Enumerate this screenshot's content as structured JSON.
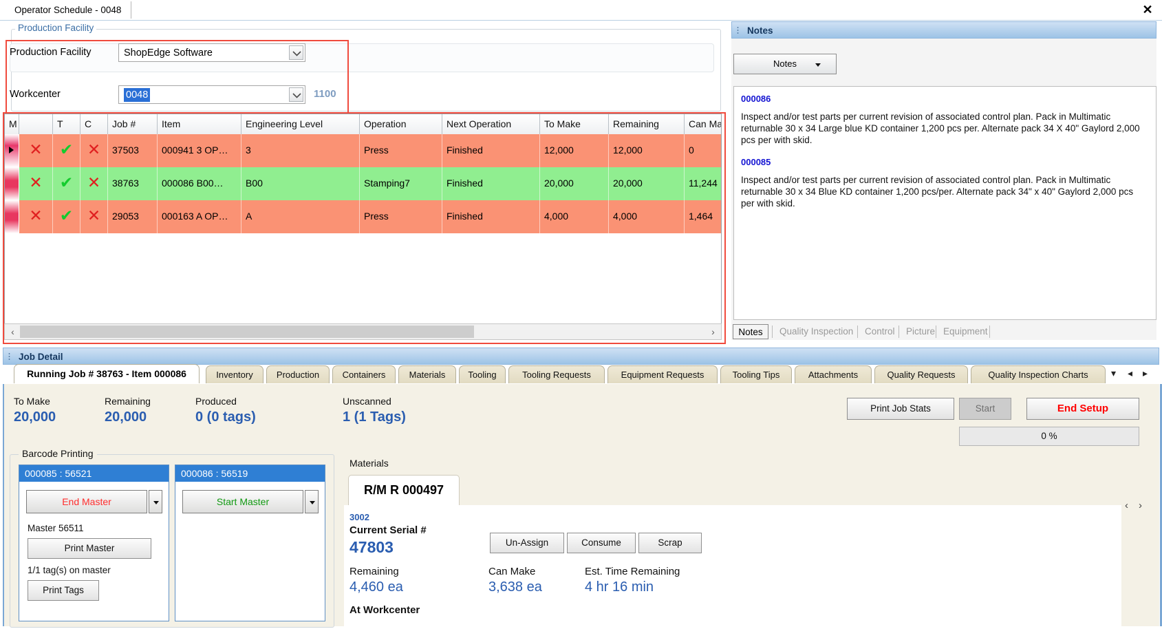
{
  "window": {
    "tab_title": "Operator Schedule - 0048",
    "close_icon": "close-icon"
  },
  "production_facility": {
    "legend": "Production Facility",
    "facility_label": "Production Facility",
    "facility_value": "ShopEdge Software",
    "workcenter_label": "Workcenter",
    "workcenter_value": "0048",
    "workcenter_code": "1100",
    "highlight_color": "#f04a3d"
  },
  "grid": {
    "columns": [
      "M",
      "",
      "T",
      "C",
      "Job #",
      "Item",
      "Engineering Level",
      "Operation",
      "Next Operation",
      "To Make",
      "Remaining",
      "Can Ma"
    ],
    "rows": [
      {
        "current": true,
        "m": "✕",
        "t": "✔",
        "c": "✕",
        "job": "37503",
        "item": "000941  3  OP…",
        "eng_level": "3",
        "operation": "Press",
        "next_operation": "Finished",
        "to_make": "12,000",
        "remaining": "12,000",
        "can_make": "0",
        "color": "#fa9274"
      },
      {
        "current": false,
        "m": "✕",
        "t": "✔",
        "c": "✕",
        "job": "38763",
        "item": "000086  B00…",
        "eng_level": "B00",
        "operation": "Stamping7",
        "next_operation": "Finished",
        "to_make": "20,000",
        "remaining": "20,000",
        "can_make": "11,244",
        "color": "#90ee90"
      },
      {
        "current": false,
        "m": "✕",
        "t": "✔",
        "c": "✕",
        "job": "29053",
        "item": "000163  A  OP…",
        "eng_level": "A",
        "operation": "Press",
        "next_operation": "Finished",
        "to_make": "4,000",
        "remaining": "4,000",
        "can_make": "1,464",
        "color": "#fa9274"
      }
    ],
    "scroll_left_icon": "chevron-left-icon",
    "scroll_right_icon": "chevron-right-icon"
  },
  "notes": {
    "panel_title": "Notes",
    "dropdown_label": "Notes",
    "entries": [
      {
        "id": "000086",
        "text": "Inspect and/or test parts per current revision of associated control plan. Pack in Multimatic returnable 30 x 34 Large blue KD container 1,200 pcs per. Alternate pack 34 X 40\" Gaylord 2,000 pcs per with skid."
      },
      {
        "id": "000085",
        "text": "Inspect and/or test parts per current revision of associated control plan. Pack in Multimatic returnable 30 x 34 Blue KD container 1,200 pcs/per. Alternate pack 34\" x 40\" Gaylord 2,000 pcs per with skid."
      }
    ],
    "tabs": [
      {
        "label": "Notes",
        "active": true
      },
      {
        "label": "Quality Inspection",
        "active": false
      },
      {
        "label": "Control",
        "active": false
      },
      {
        "label": "Picture",
        "active": false
      },
      {
        "label": "Equipment",
        "active": false
      }
    ]
  },
  "job_detail": {
    "panel_title": "Job Detail",
    "tabs": [
      {
        "label": "Running Job # 38763 - Item 000086",
        "active": true
      },
      {
        "label": "Inventory",
        "active": false
      },
      {
        "label": "Production",
        "active": false
      },
      {
        "label": "Containers",
        "active": false
      },
      {
        "label": "Materials",
        "active": false
      },
      {
        "label": "Tooling",
        "active": false
      },
      {
        "label": "Tooling Requests",
        "active": false
      },
      {
        "label": "Equipment Requests",
        "active": false
      },
      {
        "label": "Tooling Tips",
        "active": false
      },
      {
        "label": "Attachments",
        "active": false
      },
      {
        "label": "Quality Requests",
        "active": false
      },
      {
        "label": "Quality Inspection Charts",
        "active": false
      }
    ],
    "tab_overflow_icon": "tab-list-icon",
    "tab_prev_icon": "chevron-left-icon",
    "tab_next_icon": "chevron-right-icon",
    "stats": [
      {
        "label": "To Make",
        "value": "20,000"
      },
      {
        "label": "Remaining",
        "value": "20,000"
      },
      {
        "label": "Produced",
        "value": "0 (0 tags)"
      },
      {
        "label": "Unscanned",
        "value": "1 (1 Tags)"
      }
    ],
    "print_job_stats": "Print Job Stats",
    "start_button": "Start",
    "end_setup_button": "End Setup",
    "progress_text": "0 %",
    "end_setup_color": "#ff0000"
  },
  "barcode_printing": {
    "legend": "Barcode Printing",
    "cards": [
      {
        "header": "000085 : 56521",
        "action_label": "End Master",
        "action_color": "#ff2d2d",
        "master_text": "Master 56511",
        "print_master": "Print Master",
        "tags_text": "1/1 tag(s) on master",
        "print_tags": "Print Tags"
      },
      {
        "header": "000086 : 56519",
        "action_label": "Start Master",
        "action_color": "#119911",
        "master_text": "",
        "print_master": "",
        "tags_text": "",
        "print_tags": ""
      }
    ]
  },
  "materials": {
    "section_label": "Materials",
    "tab_label": "R/M R 000497",
    "location_code": "3002",
    "serial_label": "Current Serial #",
    "serial_value": "47803",
    "remaining_label": "Remaining",
    "remaining_value": "4,460 ea",
    "can_make_label": "Can Make",
    "can_make_value": "3,638 ea",
    "est_time_label": "Est. Time Remaining",
    "est_time_value": "4 hr 16 min",
    "at_workcenter_label": "At Workcenter",
    "buttons": [
      "Un-Assign",
      "Consume",
      "Scrap"
    ],
    "prev_icon": "chevron-left-icon",
    "next_icon": "chevron-right-icon"
  }
}
